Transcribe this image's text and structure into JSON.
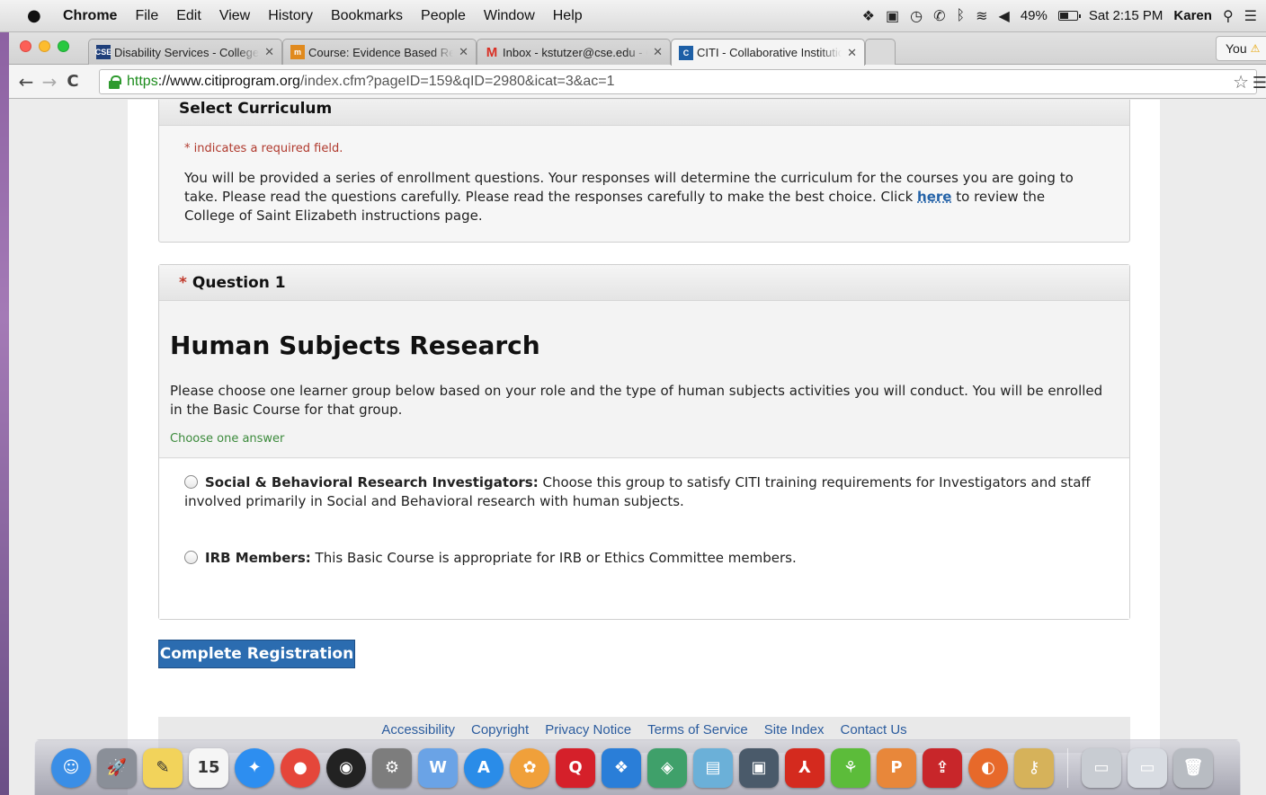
{
  "menubar": {
    "apple_icon": "apple-icon",
    "app_name": "Chrome",
    "menus": [
      "File",
      "Edit",
      "View",
      "History",
      "Bookmarks",
      "People",
      "Window",
      "Help"
    ],
    "battery": "49%",
    "clock": "Sat 2:15 PM",
    "user": "Karen"
  },
  "tabs": [
    {
      "favicon_text": "CSE",
      "title": "Disability Services - College of Saint Elizabeth",
      "color": "#1f3f7a"
    },
    {
      "favicon_text": "m",
      "title": "Course: Evidence Based Research",
      "color": "#e08a1e"
    },
    {
      "favicon_text": "M",
      "title": "Inbox - kstutzer@cse.edu - College",
      "color": "#d93025"
    },
    {
      "favicon_text": "C",
      "title": "CITI - Collaborative Institutional",
      "color": "#1d5fa6"
    }
  ],
  "profile": {
    "label": "You"
  },
  "address": {
    "scheme": "https",
    "host": "://www.citiprogram.org",
    "path": "/index.cfm?pageID=159&qID=2980&icat=3&ac=1"
  },
  "select_curriculum": {
    "heading": "Select Curriculum",
    "required_note": "* indicates a required field.",
    "intro_before": "You will be provided a series of enrollment questions. Your responses will determine the curriculum for the courses you are going to take. Please read the questions carefully. Please read the responses carefully to make the best choice. Click ",
    "link": "here",
    "intro_after": " to review the College of Saint Elizabeth instructions page."
  },
  "question": {
    "marker": "*",
    "label": "Question 1",
    "heading": "Human Subjects Research",
    "description": "Please choose one learner group below based on your role and the type of human subjects activities you will conduct. You will be enrolled in the Basic Course for that group.",
    "choose_note": "Choose one answer",
    "answers": [
      {
        "title": "Social & Behavioral Research Investigators:",
        "text": " Choose this group to satisfy CITI training requirements for Investigators and staff involved primarily in Social and Behavioral research with human subjects."
      },
      {
        "title": "IRB Members:",
        "text": " This Basic Course is appropriate for IRB or Ethics Committee members."
      }
    ]
  },
  "complete_button": "Complete Registration",
  "footer_links": [
    "Accessibility",
    "Copyright",
    "Privacy Notice",
    "Terms of Service",
    "Site Index",
    "Contact Us"
  ],
  "dock": [
    {
      "name": "finder-icon",
      "glyph": "☺",
      "color": "#3a8ee6"
    },
    {
      "name": "launchpad-icon",
      "glyph": "🚀",
      "color": "#8a8f98"
    },
    {
      "name": "stickies-icon",
      "glyph": "✎",
      "color": "#f2d35b"
    },
    {
      "name": "calendar-icon",
      "glyph": "15",
      "color": "#f5f5f5"
    },
    {
      "name": "safari-icon",
      "glyph": "✦",
      "color": "#2d8ef0"
    },
    {
      "name": "chrome-icon",
      "glyph": "●",
      "color": "#e5463a"
    },
    {
      "name": "dashboard-icon",
      "glyph": "◉",
      "color": "#222222"
    },
    {
      "name": "system-preferences-icon",
      "glyph": "⚙",
      "color": "#7d7d7d"
    },
    {
      "name": "word-icon",
      "glyph": "W",
      "color": "#6aa3e6"
    },
    {
      "name": "app-store-icon",
      "glyph": "A",
      "color": "#2a8ce8"
    },
    {
      "name": "photos-icon",
      "glyph": "✿",
      "color": "#f0a03a"
    },
    {
      "name": "quicken-icon",
      "glyph": "Q",
      "color": "#d5202a"
    },
    {
      "name": "dropbox-icon",
      "glyph": "❖",
      "color": "#2a7ed8"
    },
    {
      "name": "network-icon",
      "glyph": "◈",
      "color": "#3fa06a"
    },
    {
      "name": "screen-sharing-icon",
      "glyph": "▤",
      "color": "#6bb0d8"
    },
    {
      "name": "image-capture-icon",
      "glyph": "▣",
      "color": "#4a5a6a"
    },
    {
      "name": "acrobat-icon",
      "glyph": "⅄",
      "color": "#d42a1e"
    },
    {
      "name": "tree-app-icon",
      "glyph": "⚘",
      "color": "#5cbc3a"
    },
    {
      "name": "powerpoint-icon",
      "glyph": "P",
      "color": "#e8873a"
    },
    {
      "name": "uploader-icon",
      "glyph": "⇪",
      "color": "#c8262a"
    },
    {
      "name": "firefox-icon",
      "glyph": "◐",
      "color": "#e7692a"
    },
    {
      "name": "keychain-icon",
      "glyph": "⚷",
      "color": "#d6b25a"
    },
    {
      "name": "downloads-stack-icon",
      "glyph": "▭",
      "color": "#c8ccd2"
    },
    {
      "name": "documents-stack-icon",
      "glyph": "▭",
      "color": "#d8dce2"
    },
    {
      "name": "trash-icon",
      "glyph": "🗑",
      "color": "#b8bcc2"
    }
  ]
}
